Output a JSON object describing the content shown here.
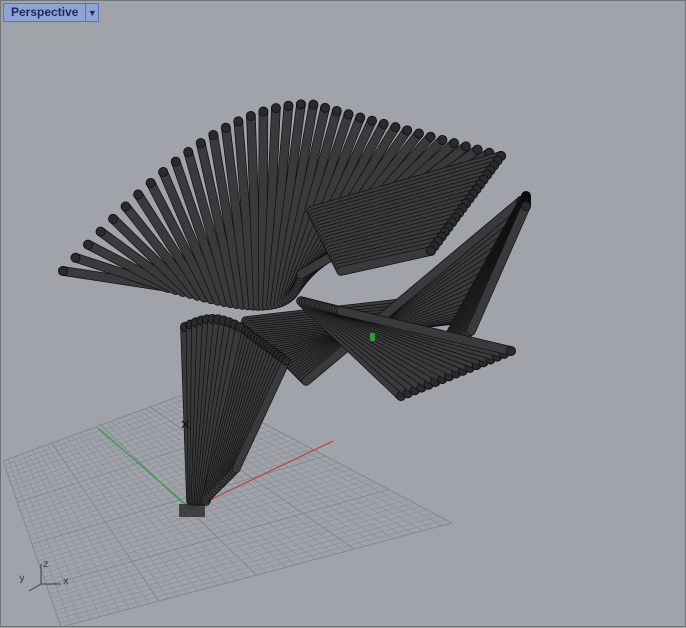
{
  "viewport": {
    "title": "Perspective",
    "menu_icon": "chevron-down-icon"
  },
  "axes": {
    "x_label": "x",
    "y_label": "y",
    "z_label": "z"
  },
  "colors": {
    "background": "#a0a4aa",
    "grid": "#8e9297",
    "x_axis": "#c04040",
    "y_axis": "#2e9b3a",
    "tube": "#2c2c2e",
    "tab": "#8fa3d6"
  }
}
